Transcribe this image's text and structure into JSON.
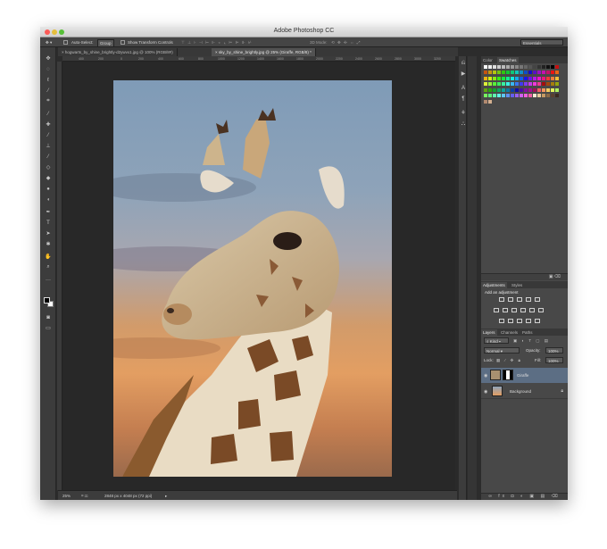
{
  "window": {
    "title": "Adobe Photoshop CC"
  },
  "options_bar": {
    "auto_select_label": "Auto-Select:",
    "auto_select_value": "Group",
    "transform_label": "Show Transform Controls",
    "mode_3d": "3D Mode:",
    "workspace": "Essentials"
  },
  "tabs": [
    {
      "label": "hogwarts_by_shine_brightly-d2ywvx1.jpg @ 100% (RGB/8#)"
    },
    {
      "label": "sky_by_shine_brightly.jpg @ 25% (Giraffe, RGB/8) *"
    }
  ],
  "ruler_ticks": [
    "400",
    "200",
    "0",
    "200",
    "400",
    "600",
    "800",
    "1000",
    "1200",
    "1400",
    "1600",
    "1800",
    "2000",
    "2200",
    "2400",
    "2600",
    "2800",
    "3000",
    "3200"
  ],
  "status": {
    "zoom": "25%",
    "doc_size": "2848 px x 4048 px (72 ppi)"
  },
  "panels": {
    "color_tabs": [
      "Color",
      "Swatches"
    ],
    "adjustment_tabs": [
      "Adjustments",
      "Styles"
    ],
    "add_adjustment": "Add an adjustment",
    "layer_tabs": [
      "Layers",
      "Channels",
      "Paths"
    ],
    "kind": "Kind",
    "blend_mode": "Normal",
    "opacity_label": "Opacity:",
    "opacity_value": "100%",
    "lock_label": "Lock:",
    "fill_label": "Fill:",
    "fill_value": "100%"
  },
  "layers": [
    {
      "name": "Giraffe",
      "selected": true
    },
    {
      "name": "Background",
      "locked": true
    }
  ],
  "colors": {
    "chrome": "#2c2c2c",
    "panel": "#484848",
    "selected_layer": "#5c6e84"
  }
}
